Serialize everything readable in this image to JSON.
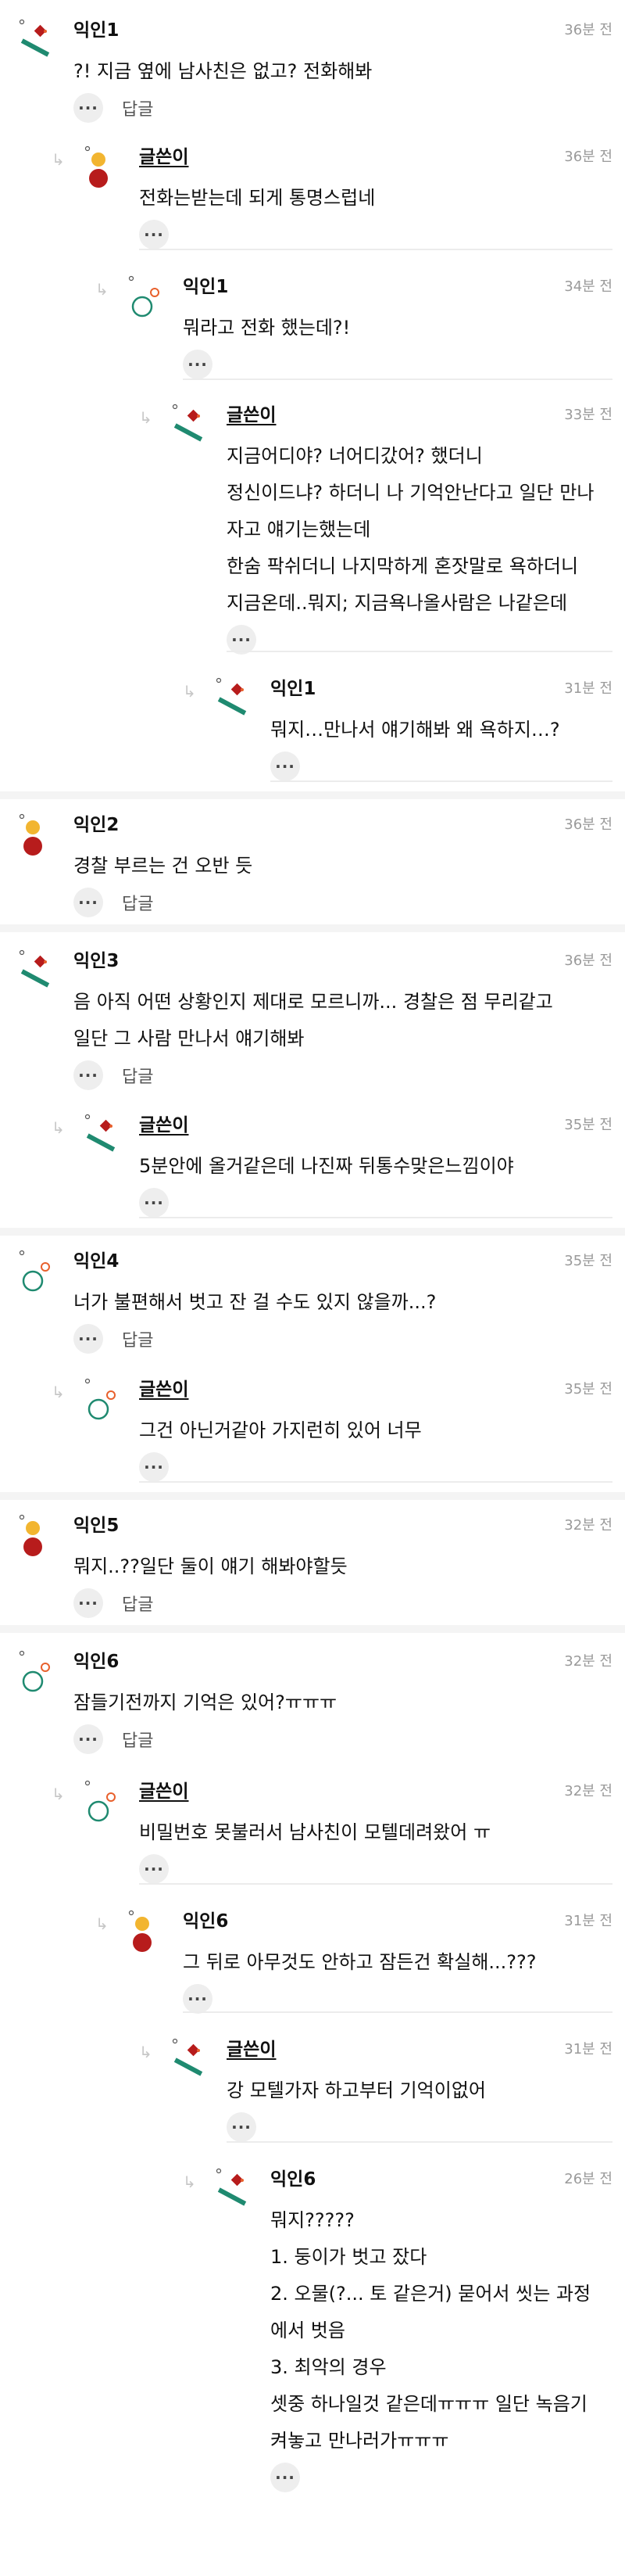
{
  "labels": {
    "reply": "답글",
    "more": "···",
    "reply_arrow": "↳"
  },
  "colors": {
    "avatar_yellow": "#f2b530",
    "avatar_red": "#b71c1c",
    "avatar_green": "#1f8a70",
    "avatar_orange": "#e8602c",
    "divider": "#ececec"
  },
  "comments": [
    {
      "nick": "익인1",
      "time": "36분 전",
      "avatar": "flag-icon",
      "lines": [
        "?! 지금 옆에 남사친은 없고? 전화해봐"
      ],
      "reply": true
    },
    {
      "nick": "글쓴이",
      "time": "36분 전",
      "avatar": "person-icon",
      "lines": [
        "전화는받는데 되게 통명스럽네"
      ],
      "reply": false
    },
    {
      "nick": "익인1",
      "time": "34분 전",
      "avatar": "circle-icon",
      "lines": [
        "뭐라고 전화 했는데?!"
      ],
      "reply": false
    },
    {
      "nick": "글쓴이",
      "time": "33분 전",
      "avatar": "flag-icon",
      "lines": [
        "지금어디야? 너어디갔어? 했더니",
        "정신이드냐? 하더니 나 기억안난다고 일단 만나",
        "자고 얘기는했는데",
        "한숨 팍쉬더니 나지막하게 혼잣말로 욕하더니",
        "지금온데..뭐지; 지금욕나올사람은 나같은데"
      ],
      "reply": false
    },
    {
      "nick": "익인1",
      "time": "31분 전",
      "avatar": "flag-icon",
      "lines": [
        "뭐지…만나서 얘기해봐 왜 욕하지…?"
      ],
      "reply": false
    },
    {
      "nick": "익인2",
      "time": "36분 전",
      "avatar": "person-icon",
      "lines": [
        "경찰 부르는 건 오반 듯"
      ],
      "reply": true
    },
    {
      "nick": "익인3",
      "time": "36분 전",
      "avatar": "flag-icon",
      "lines": [
        "음 아직 어떤 상황인지 제대로 모르니까... 경찰은 점 무리같고",
        "일단 그 사람 만나서 얘기해봐"
      ],
      "reply": true
    },
    {
      "nick": "글쓴이",
      "time": "35분 전",
      "avatar": "flag-icon",
      "lines": [
        "5분안에 올거같은데 나진짜 뒤통수맞은느낌이야"
      ],
      "reply": false
    },
    {
      "nick": "익인4",
      "time": "35분 전",
      "avatar": "circle-icon",
      "lines": [
        "너가 불편해서 벗고 잔 걸 수도 있지 않을까...?"
      ],
      "reply": true
    },
    {
      "nick": "글쓴이",
      "time": "35분 전",
      "avatar": "circle-icon",
      "lines": [
        "그건 아닌거같아 가지런히 있어 너무"
      ],
      "reply": false
    },
    {
      "nick": "익인5",
      "time": "32분 전",
      "avatar": "person-icon",
      "lines": [
        "뭐지..??일단 둘이 얘기 해봐야할듯"
      ],
      "reply": true
    },
    {
      "nick": "익인6",
      "time": "32분 전",
      "avatar": "circle-icon",
      "lines": [
        "잠들기전까지 기억은 있어?ㅠㅠㅠ"
      ],
      "reply": true
    },
    {
      "nick": "글쓴이",
      "time": "32분 전",
      "avatar": "circle-icon",
      "lines": [
        "비밀번호 못불러서 남사친이 모텔데려왔어 ㅠ"
      ],
      "reply": false
    },
    {
      "nick": "익인6",
      "time": "31분 전",
      "avatar": "person-icon",
      "lines": [
        "그 뒤로 아무것도 안하고 잠든건 확실해...???"
      ],
      "reply": false
    },
    {
      "nick": "글쓴이",
      "time": "31분 전",
      "avatar": "flag-icon",
      "lines": [
        "강 모텔가자 하고부터 기억이없어"
      ],
      "reply": false
    },
    {
      "nick": "익인6",
      "time": "26분 전",
      "avatar": "flag-icon",
      "lines": [
        "뭐지?????",
        "1. 둥이가 벗고 잤다",
        "2. 오물(?... 토 같은거) 묻어서 씻는 과정",
        "에서 벗음",
        "3. 최악의 경우",
        "셋중 하나일것 같은데ㅠㅠㅠ 일단 녹음기",
        "켜놓고 만나러가ㅠㅠㅠ"
      ],
      "reply": false
    }
  ]
}
